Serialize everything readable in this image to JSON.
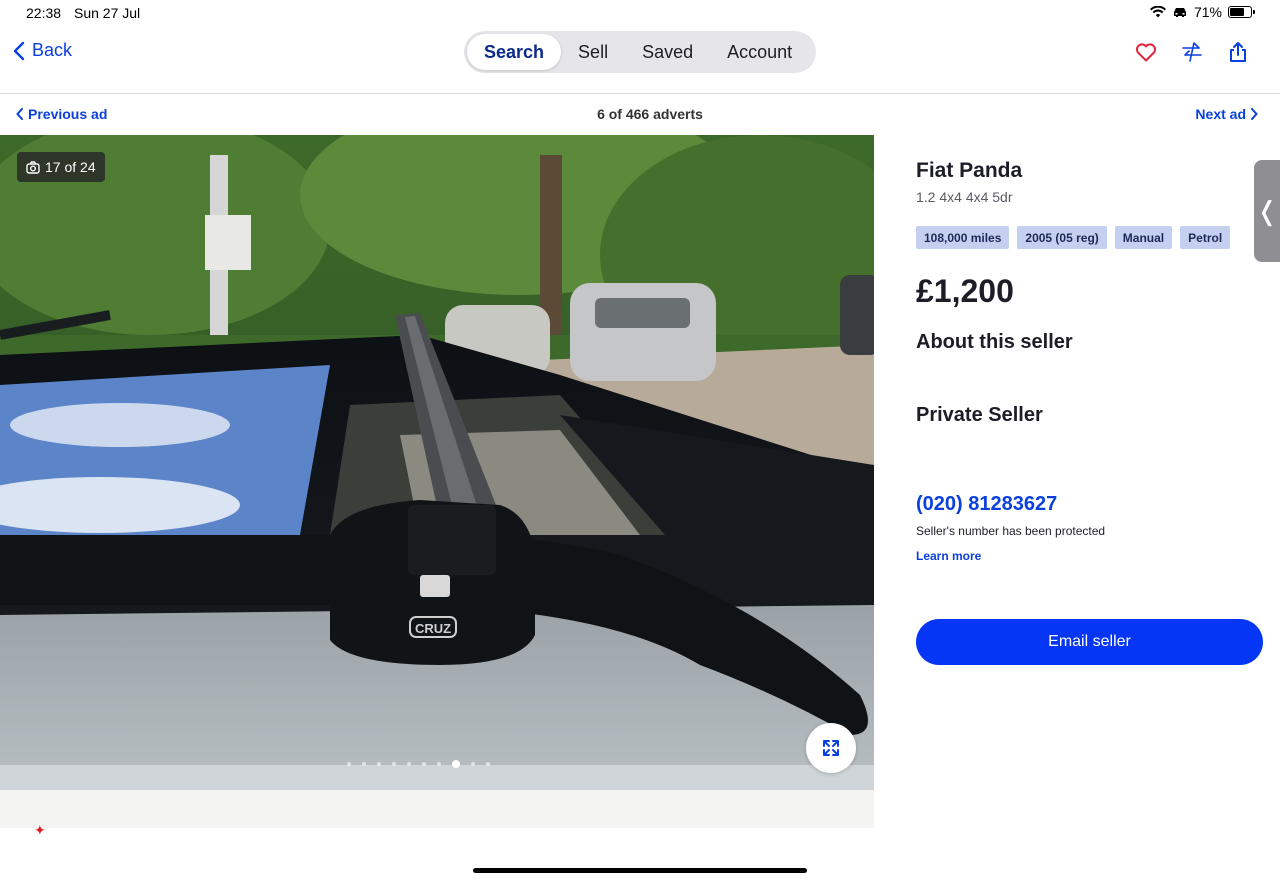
{
  "status": {
    "time": "22:38",
    "date": "Sun 27 Jul",
    "battery": "71%",
    "battery_level": 0.71
  },
  "nav": {
    "back_label": "Back",
    "tabs": [
      {
        "label": "Search",
        "active": true
      },
      {
        "label": "Sell",
        "active": false
      },
      {
        "label": "Saved",
        "active": false
      },
      {
        "label": "Account",
        "active": false
      }
    ],
    "actions": [
      "heart-icon",
      "compare-icon",
      "share-icon"
    ]
  },
  "adnav": {
    "previous_label": "Previous ad",
    "count": "6 of 466 adverts",
    "next_label": "Next ad"
  },
  "gallery": {
    "counter": "17 of 24",
    "dots_total": 10,
    "dots_active_index": 7
  },
  "listing": {
    "title": "Fiat Panda",
    "subtitle": "1.2 4x4 4x4 5dr",
    "chips": [
      "108,000 miles",
      "2005 (05 reg)",
      "Manual",
      "Petrol"
    ],
    "price": "£1,200",
    "about_heading": "About this seller",
    "seller_type": "Private Seller",
    "phone": "(020) 81283627",
    "protected_note": "Seller's number has been protected",
    "learn_more": "Learn more",
    "email_button": "Email seller"
  },
  "colors": {
    "accent": "#0535f5",
    "link": "#0a3fe0",
    "chip_bg": "#c5cff0",
    "heart": "#e0253a"
  }
}
